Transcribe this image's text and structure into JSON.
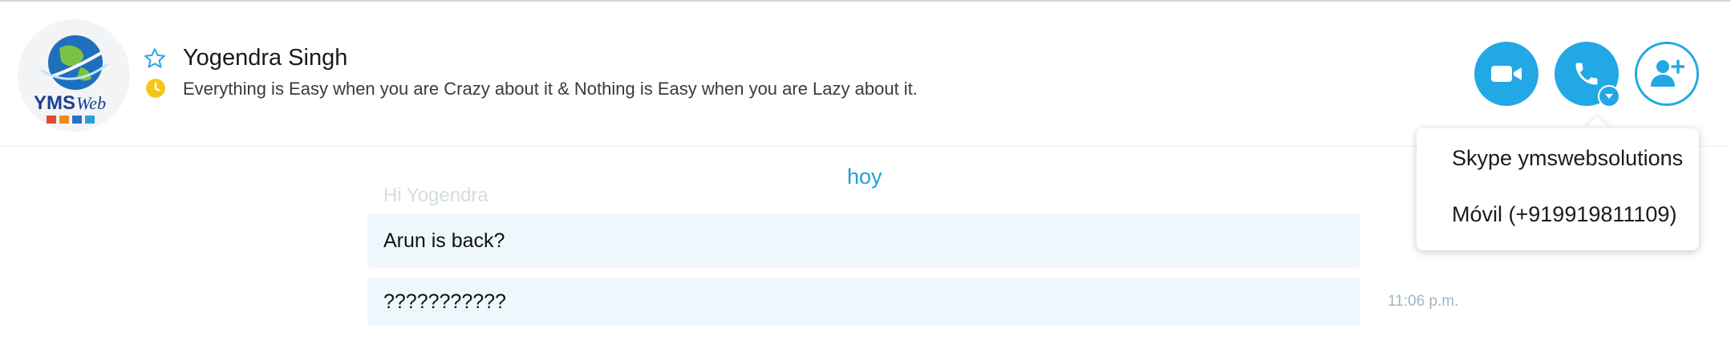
{
  "contact": {
    "name": "Yogendra Singh",
    "mood": "Everything is Easy when you are Crazy about it & Nothing is Easy when you are Lazy about it.",
    "avatar_logo": "YMS Web"
  },
  "actions": {
    "video_icon": "video-camera-icon",
    "call_icon": "phone-icon",
    "add_icon": "add-person-icon"
  },
  "call_menu": {
    "items": [
      {
        "label": "Skype ymswebsolutions"
      },
      {
        "label": "Móvil (+919919811109)"
      }
    ]
  },
  "conversation": {
    "day_label": "hoy",
    "previous_message": "Hi Yogendra",
    "messages": [
      {
        "text": "Arun is back?",
        "time": ""
      },
      {
        "text": "???????????",
        "time": "11:06 p.m."
      }
    ]
  },
  "colors": {
    "accent": "#22a8e4",
    "bubble": "#eef8fc",
    "status_yellow": "#f5c518"
  }
}
